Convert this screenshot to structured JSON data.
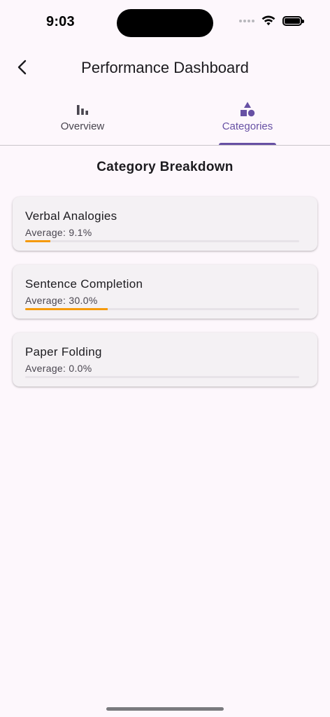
{
  "status_bar": {
    "time": "9:03"
  },
  "header": {
    "title": "Performance Dashboard"
  },
  "tabs": [
    {
      "label": "Overview",
      "icon": "bar-chart-icon",
      "selected": false
    },
    {
      "label": "Categories",
      "icon": "shapes-icon",
      "selected": true
    }
  ],
  "section": {
    "title": "Category Breakdown"
  },
  "categories": [
    {
      "name": "Verbal Analogies",
      "average_text": "Average: 9.1%",
      "average": 9.1
    },
    {
      "name": "Sentence Completion",
      "average_text": "Average: 30.0%",
      "average": 30.0
    },
    {
      "name": "Paper Folding",
      "average_text": "Average: 0.0%",
      "average": 0.0
    }
  ],
  "colors": {
    "accent": "#6750a4",
    "progress": "#f59a0c",
    "track": "#e7e3e8",
    "background": "#fdf7fc"
  }
}
